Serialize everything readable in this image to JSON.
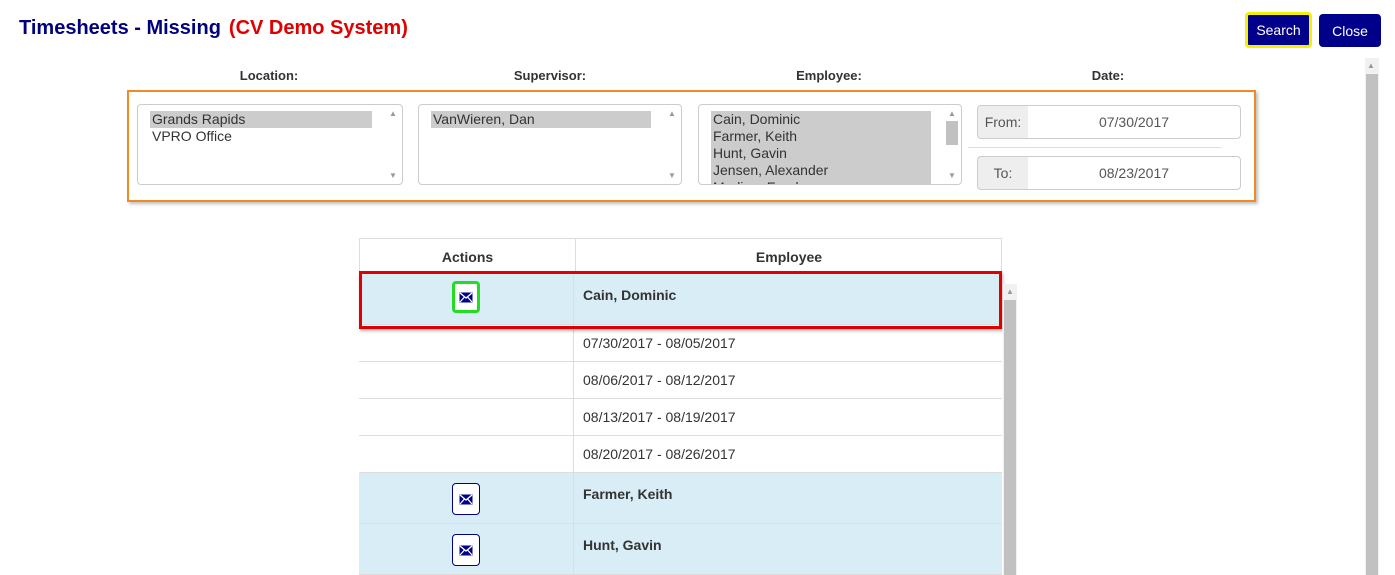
{
  "header": {
    "title": "Timesheets - Missing",
    "system": "(CV Demo System)",
    "search_label": "Search",
    "close_label": "Close"
  },
  "filters": {
    "location_label": "Location:",
    "supervisor_label": "Supervisor:",
    "employee_label": "Employee:",
    "date_label": "Date:",
    "locations": [
      {
        "label": "Grands Rapids",
        "selected": true
      },
      {
        "label": "VPRO Office",
        "selected": false
      }
    ],
    "supervisors": [
      {
        "label": "VanWieren, Dan",
        "selected": true
      }
    ],
    "employees": [
      {
        "label": "Cain, Dominic",
        "selected": true
      },
      {
        "label": "Farmer, Keith",
        "selected": true
      },
      {
        "label": "Hunt, Gavin",
        "selected": true
      },
      {
        "label": "Jensen, Alexander",
        "selected": true
      },
      {
        "label": "Medina, Frank",
        "selected": true
      }
    ],
    "from_label": "From:",
    "from_value": "07/30/2017",
    "to_label": "To:",
    "to_value": "08/23/2017"
  },
  "table": {
    "col_actions": "Actions",
    "col_employee": "Employee",
    "rows": [
      {
        "type": "employee",
        "text": "Cain, Dominic"
      },
      {
        "type": "period",
        "text": "07/30/2017 - 08/05/2017"
      },
      {
        "type": "period",
        "text": "08/06/2017 - 08/12/2017"
      },
      {
        "type": "period",
        "text": "08/13/2017 - 08/19/2017"
      },
      {
        "type": "period",
        "text": "08/20/2017 - 08/26/2017"
      },
      {
        "type": "employee",
        "text": "Farmer, Keith"
      },
      {
        "type": "employee",
        "text": "Hunt, Gavin"
      }
    ]
  },
  "icons": {
    "mail": "envelope-icon"
  },
  "colors": {
    "title": "#000080",
    "system": "#e00000",
    "button": "#00008b",
    "employee_row": "#d9edf7",
    "filter_outline": "#f08a24",
    "selected_outline": "#e00000",
    "action_outline": "#22dd22",
    "search_outline": "#f5f000"
  }
}
